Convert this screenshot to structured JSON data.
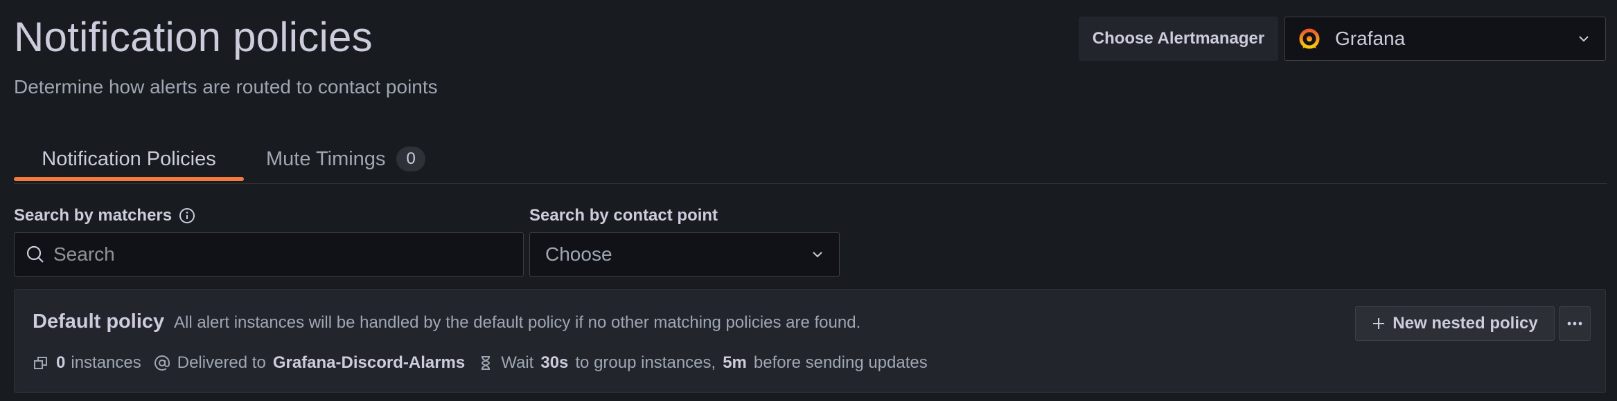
{
  "header": {
    "title": "Notification policies",
    "subtitle": "Determine how alerts are routed to contact points"
  },
  "alertmanager": {
    "label": "Choose Alertmanager",
    "selected": "Grafana"
  },
  "tabs": [
    {
      "label": "Notification Policies",
      "active": true
    },
    {
      "label": "Mute Timings",
      "count": "0",
      "active": false
    }
  ],
  "filters": {
    "matchers_label": "Search by matchers",
    "matchers_placeholder": "Search",
    "contact_point_label": "Search by contact point",
    "contact_point_value": "Choose"
  },
  "policy": {
    "title": "Default policy",
    "description": "All alert instances will be handled by the default policy if no other matching policies are found.",
    "new_nested_label": "New nested policy",
    "instances_count": "0",
    "instances_label": "instances",
    "delivered_prefix": "Delivered to",
    "contact_point": "Grafana-Discord-Alarms",
    "wait_prefix": "Wait",
    "group_wait": "30s",
    "group_wait_suffix": "to group instances,",
    "group_interval": "5m",
    "group_interval_suffix": "before sending updates"
  },
  "colors": {
    "background": "#181b1f",
    "accent": "#f5783c"
  }
}
